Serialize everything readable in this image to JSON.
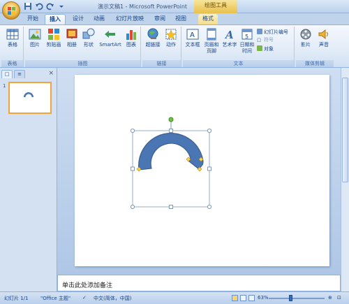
{
  "window": {
    "title": "演示文稿1 - Microsoft PowerPoint",
    "context_tab_group": "绘图工具"
  },
  "quick_access": [
    "save-icon",
    "undo-icon",
    "redo-icon",
    "customize-icon"
  ],
  "tabs": [
    {
      "label": "开始"
    },
    {
      "label": "插入"
    },
    {
      "label": "设计"
    },
    {
      "label": "动画"
    },
    {
      "label": "幻灯片放映"
    },
    {
      "label": "审阅"
    },
    {
      "label": "视图"
    },
    {
      "label": "格式"
    }
  ],
  "active_tab": "插入",
  "ribbon": {
    "groups": {
      "tables": "表格",
      "illustrations": "插图",
      "links": "链接",
      "text": "文本",
      "media": "媒体剪辑"
    },
    "buttons": {
      "table": "表格",
      "picture": "图片",
      "clipart": "剪贴画",
      "album": "相册",
      "shapes": "形状",
      "smartart": "SmartArt",
      "chart": "图表",
      "hyperlink": "超链接",
      "action": "动作",
      "textbox": "文本框",
      "header_footer_1": "页眉和",
      "header_footer_2": "页脚",
      "wordart": "艺术字",
      "datetime_1": "日期和",
      "datetime_2": "时间",
      "slide_number": "幻灯片编号",
      "symbol": "符号",
      "object": "对象",
      "movie": "影片",
      "sound": "声音"
    }
  },
  "left_panel": {
    "tab_slides": "□",
    "tab_outline": "≡",
    "close": "×",
    "thumbnail_number": "1"
  },
  "notes": {
    "placeholder": "单击此处添加备注"
  },
  "status": {
    "slide_info": "幻灯片 1/1",
    "theme": "\"Office 主题\"",
    "language": "中文(简体，中国)",
    "zoom": "63%",
    "zoom_fraction": 0.63
  },
  "colors": {
    "shape_fill": "#4a77b4",
    "shape_outline": "#3a5f92",
    "selection_handle": "#9fbfe0",
    "adjust_handle": "#ffd54a",
    "rotate_handle": "#6ec24a",
    "thumbnail_border": "#f2a33a",
    "accent": "#15428b"
  }
}
